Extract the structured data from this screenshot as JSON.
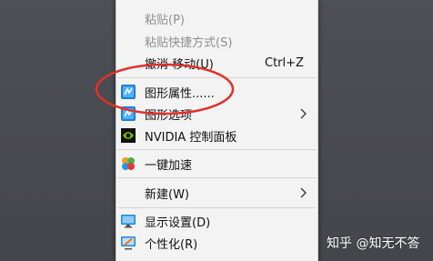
{
  "context_menu": {
    "items": [
      {
        "label": "粘贴(P)",
        "disabled": true
      },
      {
        "label": "粘贴快捷方式(S)",
        "disabled": true
      },
      {
        "label": "撤消 移动(U)",
        "shortcut": "Ctrl+Z"
      },
      {
        "label": "图形属性......",
        "icon": "intel-graphics-properties-icon"
      },
      {
        "label": "图形选项",
        "icon": "intel-graphics-options-icon",
        "submenu": true
      },
      {
        "label": "NVIDIA 控制面板",
        "icon": "nvidia-icon"
      },
      {
        "label": "一键加速",
        "icon": "speedup-icon"
      },
      {
        "label": "新建(W)",
        "submenu": true
      },
      {
        "label": "显示设置(D)",
        "icon": "display-settings-icon"
      },
      {
        "label": "个性化(R)",
        "icon": "personalize-icon"
      }
    ]
  },
  "annotation": {
    "color": "#e0312a"
  },
  "watermark": {
    "text": "知乎 @知无不答"
  }
}
